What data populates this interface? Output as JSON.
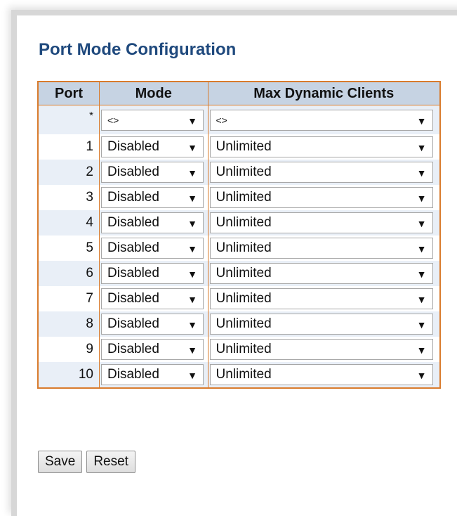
{
  "page": {
    "title": "Port Mode Configuration"
  },
  "table": {
    "headers": {
      "port": "Port",
      "mode": "Mode",
      "max_clients": "Max Dynamic Clients"
    },
    "global_row": {
      "port": "*",
      "mode": "<>",
      "max_clients": "<>"
    },
    "rows": [
      {
        "port": "1",
        "mode": "Disabled",
        "max_clients": "Unlimited"
      },
      {
        "port": "2",
        "mode": "Disabled",
        "max_clients": "Unlimited"
      },
      {
        "port": "3",
        "mode": "Disabled",
        "max_clients": "Unlimited"
      },
      {
        "port": "4",
        "mode": "Disabled",
        "max_clients": "Unlimited"
      },
      {
        "port": "5",
        "mode": "Disabled",
        "max_clients": "Unlimited"
      },
      {
        "port": "6",
        "mode": "Disabled",
        "max_clients": "Unlimited"
      },
      {
        "port": "7",
        "mode": "Disabled",
        "max_clients": "Unlimited"
      },
      {
        "port": "8",
        "mode": "Disabled",
        "max_clients": "Unlimited"
      },
      {
        "port": "9",
        "mode": "Disabled",
        "max_clients": "Unlimited"
      },
      {
        "port": "10",
        "mode": "Disabled",
        "max_clients": "Unlimited"
      }
    ],
    "dropdown_arrow": "▼"
  },
  "buttons": {
    "save_label": "Save",
    "reset_label": "Reset"
  },
  "colors": {
    "title": "#1f497d",
    "header_bg": "#c6d3e3",
    "table_border": "#d97b2c",
    "alt_row_bg": "#e9eff7"
  },
  "icons": {
    "dropdown": "chevron-down-icon"
  }
}
